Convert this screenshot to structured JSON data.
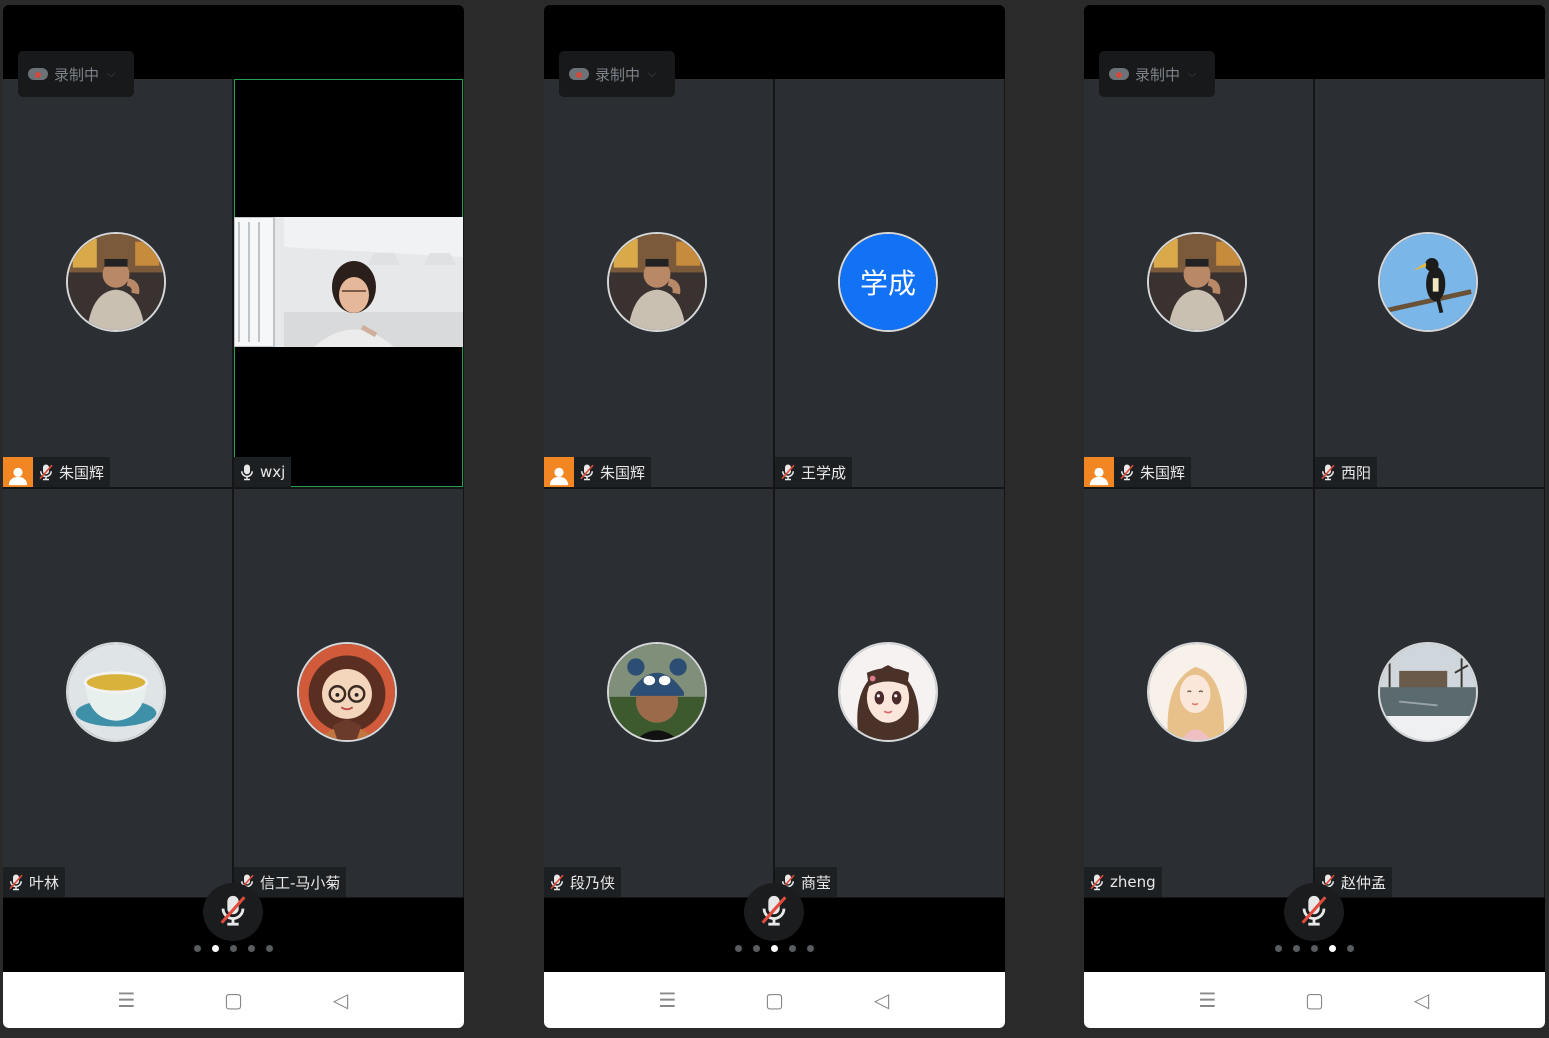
{
  "recording_label": "录制中",
  "colors": {
    "host_badge": "#f28622",
    "active_border": "#26a04d",
    "initials_avatar": "#1272f5",
    "muted_slash": "#e14b3b"
  },
  "phones": [
    {
      "page_indicator": {
        "total": 5,
        "current": 2
      },
      "tiles": [
        {
          "name": "朱国辉",
          "host": true,
          "muted": true,
          "avatar": "photo-man-cafe"
        },
        {
          "name": "wxj",
          "host": false,
          "muted": false,
          "avatar": "video-woman-office",
          "active": true
        },
        {
          "name": "叶林",
          "host": false,
          "muted": true,
          "avatar": "tea-cup"
        },
        {
          "name": "信工-马小菊",
          "host": false,
          "muted": true,
          "avatar": "cartoon-girl-glasses"
        }
      ]
    },
    {
      "page_indicator": {
        "total": 5,
        "current": 3
      },
      "tiles": [
        {
          "name": "朱国辉",
          "host": true,
          "muted": true,
          "avatar": "photo-man-cafe"
        },
        {
          "name": "王学成",
          "host": false,
          "muted": true,
          "avatar": "initials",
          "initials": "学成"
        },
        {
          "name": "段乃侠",
          "host": false,
          "muted": true,
          "avatar": "boy-panda-cap"
        },
        {
          "name": "商莹",
          "host": false,
          "muted": true,
          "avatar": "anime-girl"
        }
      ]
    },
    {
      "page_indicator": {
        "total": 5,
        "current": 4
      },
      "tiles": [
        {
          "name": "朱国辉",
          "host": true,
          "muted": true,
          "avatar": "photo-man-cafe"
        },
        {
          "name": "西阳",
          "host": false,
          "muted": true,
          "avatar": "hornbill-bird"
        },
        {
          "name": "zheng",
          "host": false,
          "muted": true,
          "avatar": "illustrated-woman"
        },
        {
          "name": "赵仲孟",
          "host": false,
          "muted": true,
          "avatar": "winter-lake"
        }
      ]
    }
  ],
  "navbar": [
    {
      "name": "menu-nav-icon",
      "glyph": "☰"
    },
    {
      "name": "home-nav-icon",
      "glyph": "▢"
    },
    {
      "name": "back-nav-icon",
      "glyph": "◁"
    }
  ]
}
